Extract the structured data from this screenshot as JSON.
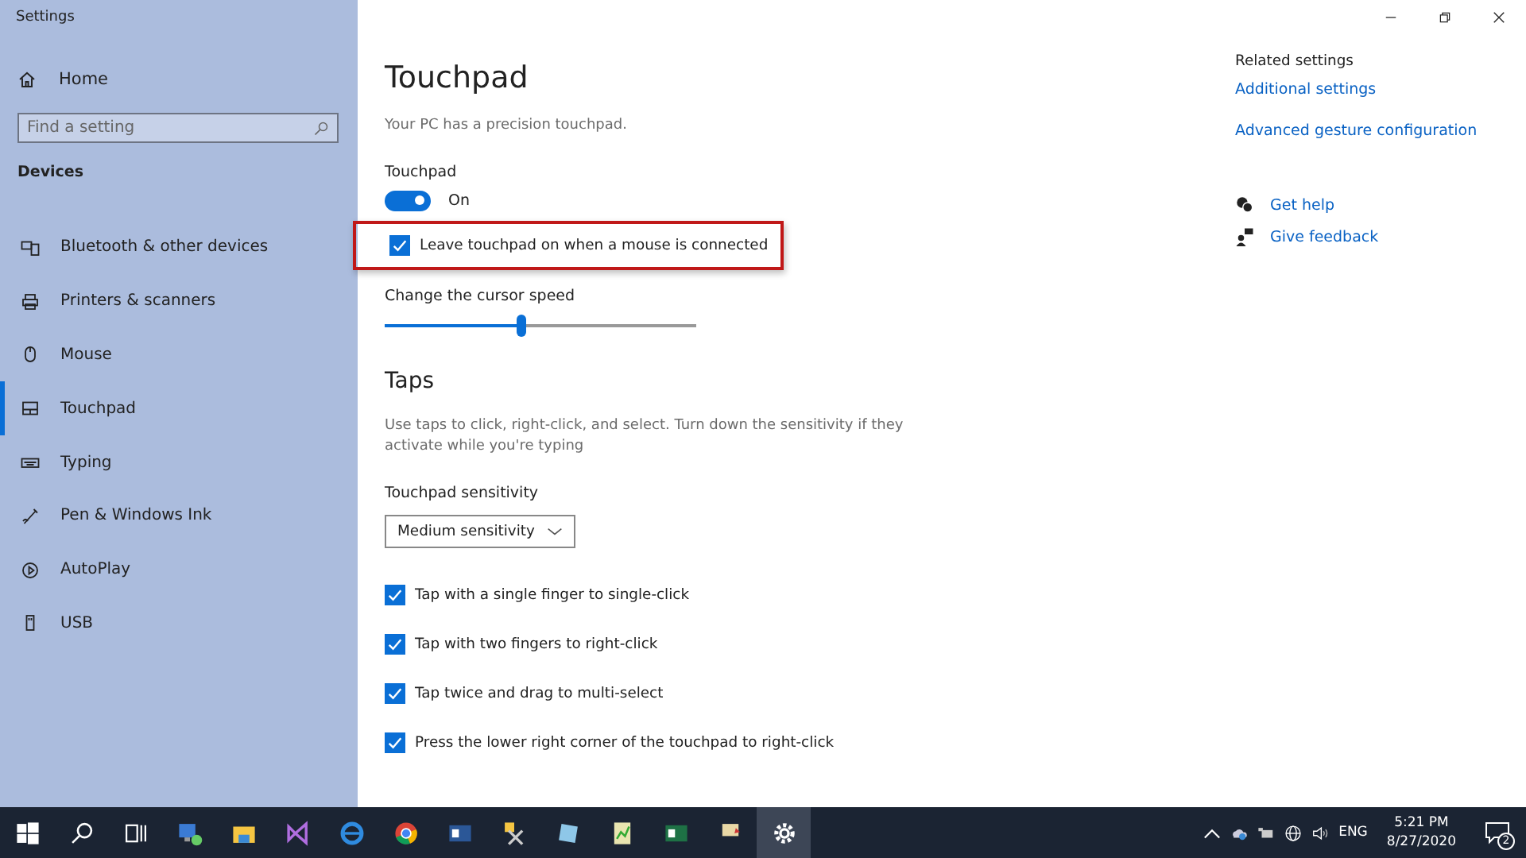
{
  "window": {
    "title": "Settings",
    "controls": [
      {
        "kind": "minimize"
      },
      {
        "kind": "restore"
      },
      {
        "kind": "close"
      }
    ]
  },
  "sidebar": {
    "home": "Home",
    "search": {
      "placeholder": "Find a setting"
    },
    "section": "Devices",
    "items": [
      {
        "label": "Bluetooth & other devices",
        "kind": "bluetooth",
        "selected": false
      },
      {
        "label": "Printers & scanners",
        "kind": "printer",
        "selected": false
      },
      {
        "label": "Mouse",
        "kind": "mouse",
        "selected": false
      },
      {
        "label": "Touchpad",
        "kind": "touchpad",
        "selected": true
      },
      {
        "label": "Typing",
        "kind": "keyboard",
        "selected": false
      },
      {
        "label": "Pen & Windows Ink",
        "kind": "pen",
        "selected": false
      },
      {
        "label": "AutoPlay",
        "kind": "autoplay",
        "selected": false
      },
      {
        "label": "USB",
        "kind": "usb",
        "selected": false
      }
    ]
  },
  "main": {
    "title": "Touchpad",
    "subtitle": "Your PC has a precision touchpad.",
    "toggle": {
      "label": "Touchpad",
      "on": true,
      "state": "On"
    },
    "leave_on": {
      "label": "Leave touchpad on when a mouse is connected",
      "checked": true,
      "highlighted": true
    },
    "cursor_speed": {
      "label": "Change the cursor speed",
      "level": 0.44
    },
    "taps": {
      "heading": "Taps",
      "description": "Use taps to click, right-click, and select. Turn down the sensitivity if they activate while you're typing",
      "sensitivity": {
        "label": "Touchpad sensitivity",
        "value": "Medium sensitivity"
      },
      "options": [
        {
          "label": "Tap with a single finger to single-click",
          "checked": true
        },
        {
          "label": "Tap with two fingers to right-click",
          "checked": true
        },
        {
          "label": "Tap twice and drag to multi-select",
          "checked": true
        },
        {
          "label": "Press the lower right corner of the touchpad to right-click",
          "checked": true
        }
      ]
    }
  },
  "related": {
    "heading": "Related settings",
    "links": [
      "Additional settings",
      "Advanced gesture configuration"
    ],
    "help": [
      {
        "label": "Get help",
        "kind": "help"
      },
      {
        "label": "Give feedback",
        "kind": "feedback"
      }
    ]
  },
  "taskbar": {
    "apps": [
      {
        "kind": "start",
        "selected": false
      },
      {
        "kind": "search",
        "selected": false
      },
      {
        "kind": "taskview",
        "selected": false
      },
      {
        "kind": "network",
        "selected": false
      },
      {
        "kind": "folder",
        "selected": false
      },
      {
        "kind": "studio",
        "selected": false
      },
      {
        "kind": "ie",
        "selected": false
      },
      {
        "kind": "chrome",
        "selected": false
      },
      {
        "kind": "word",
        "selected": false
      },
      {
        "kind": "tools",
        "selected": false
      },
      {
        "kind": "note",
        "selected": false
      },
      {
        "kind": "sheet",
        "selected": false
      },
      {
        "kind": "excel",
        "selected": false
      },
      {
        "kind": "flag",
        "selected": false
      },
      {
        "kind": "gear",
        "selected": true
      }
    ],
    "tray": {
      "language": "ENG",
      "time": "5:21 PM",
      "date": "8/27/2020",
      "notifications": "2"
    }
  }
}
